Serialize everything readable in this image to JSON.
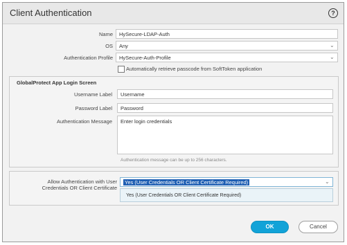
{
  "dialog": {
    "title": "Client Authentication",
    "help_icon": "help-icon"
  },
  "form": {
    "name_label": "Name",
    "name_value": "HySecure-LDAP-Auth",
    "os_label": "OS",
    "os_value": "Any",
    "auth_profile_label": "Authentication Profile",
    "auth_profile_value": "HySecure-Auth-Profile",
    "auto_retrieve_label": "Automatically retrieve passcode from SoftToken application",
    "auto_retrieve_checked": false
  },
  "login_screen": {
    "title": "GlobalProtect App Login Screen",
    "username_label": "Username Label",
    "username_value": "Username",
    "password_label": "Password Label",
    "password_value": "Password",
    "auth_message_label": "Authentication Message",
    "auth_message_value": "Enter login credentials",
    "auth_message_hint": "Authentication message can be up to 256 characters."
  },
  "allow_auth": {
    "label_line1": "Allow Authentication with User",
    "label_line2": "Credentials OR Client Certificate",
    "selected_value": "Yes (User Credentials OR Client Certificate Required)",
    "options": [
      "Yes (User Credentials OR Client Certificate Required)"
    ]
  },
  "buttons": {
    "ok": "OK",
    "cancel": "Cancel"
  },
  "colors": {
    "accent": "#12a3d8",
    "selection": "#1f5fb3"
  }
}
